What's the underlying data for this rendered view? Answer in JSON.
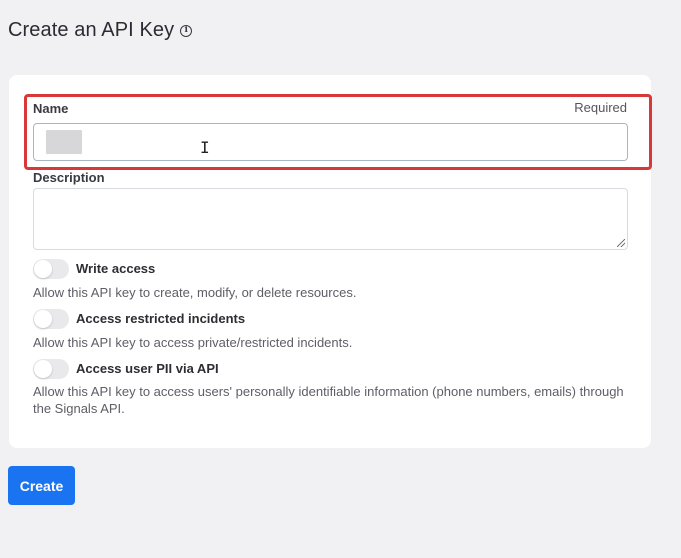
{
  "page": {
    "title": "Create an API Key",
    "info_icon": "info-circle-icon"
  },
  "form": {
    "name_label": "Name",
    "name_required": "Required",
    "name_value": "",
    "description_label": "Description",
    "description_value": "",
    "toggles": [
      {
        "label": "Write access",
        "description": "Allow this API key to create, modify, or delete resources.",
        "enabled": false
      },
      {
        "label": "Access restricted incidents",
        "description": "Allow this API key to access private/restricted incidents.",
        "enabled": false
      },
      {
        "label": "Access user PII via API",
        "description": "Allow this API key to access users' personally identifiable information (phone numbers, emails) through the Signals API.",
        "enabled": false
      }
    ]
  },
  "actions": {
    "create_label": "Create"
  },
  "colors": {
    "primary": "#1a73f0",
    "highlight": "#d9383a",
    "background": "#f1f1f3"
  }
}
